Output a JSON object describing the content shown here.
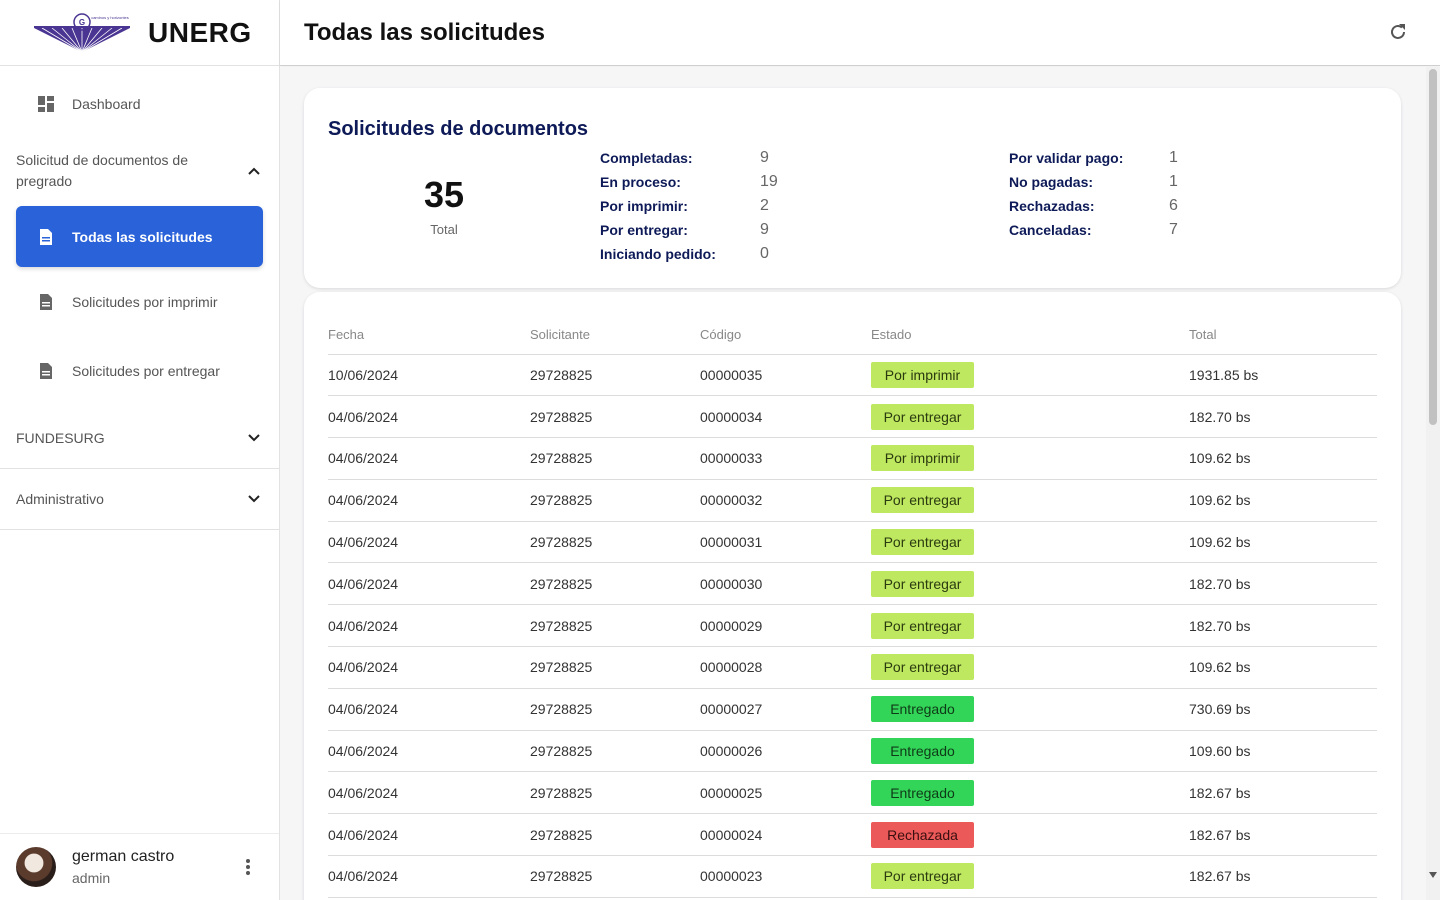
{
  "brand": {
    "name": "UNERG",
    "logo_tagline": "caminos y horizontes"
  },
  "header": {
    "title": "Todas las solicitudes"
  },
  "sidebar": {
    "dashboard": "Dashboard",
    "group_undergrad": "Solicitud de documentos de pregrado",
    "sub_items": [
      "Todas las solicitudes",
      "Solicitudes por imprimir",
      "Solicitudes por entregar"
    ],
    "group_fund": "FUNDESURG",
    "group_admin": "Administrativo"
  },
  "user": {
    "name": "german castro",
    "role": "admin"
  },
  "summary": {
    "title": "Solicitudes de documentos",
    "total": "35",
    "total_label": "Total",
    "col1": [
      {
        "label": "Completadas:",
        "value": "9"
      },
      {
        "label": "En proceso:",
        "value": "19"
      },
      {
        "label": "Por imprimir:",
        "value": "2"
      },
      {
        "label": "Por entregar:",
        "value": "9"
      },
      {
        "label": "Iniciando pedido:",
        "value": "0"
      }
    ],
    "col2": [
      {
        "label": "Por validar pago:",
        "value": "1"
      },
      {
        "label": "No pagadas:",
        "value": "1"
      },
      {
        "label": "Rechazadas:",
        "value": "6"
      },
      {
        "label": "Canceladas:",
        "value": "7"
      }
    ]
  },
  "table": {
    "headers": [
      "Fecha",
      "Solicitante",
      "Código",
      "Estado",
      "Total"
    ],
    "status_colors": {
      "Por imprimir": "#bde85f",
      "Por entregar": "#bde85f",
      "Entregado": "#32d558",
      "Rechazada": "#ec5959"
    },
    "rows": [
      {
        "fecha": "10/06/2024",
        "solicitante": "29728825",
        "codigo": "00000035",
        "estado": "Por imprimir",
        "total": "1931.85 bs"
      },
      {
        "fecha": "04/06/2024",
        "solicitante": "29728825",
        "codigo": "00000034",
        "estado": "Por entregar",
        "total": "182.70 bs"
      },
      {
        "fecha": "04/06/2024",
        "solicitante": "29728825",
        "codigo": "00000033",
        "estado": "Por imprimir",
        "total": "109.62 bs"
      },
      {
        "fecha": "04/06/2024",
        "solicitante": "29728825",
        "codigo": "00000032",
        "estado": "Por entregar",
        "total": "109.62 bs"
      },
      {
        "fecha": "04/06/2024",
        "solicitante": "29728825",
        "codigo": "00000031",
        "estado": "Por entregar",
        "total": "109.62 bs"
      },
      {
        "fecha": "04/06/2024",
        "solicitante": "29728825",
        "codigo": "00000030",
        "estado": "Por entregar",
        "total": "182.70 bs"
      },
      {
        "fecha": "04/06/2024",
        "solicitante": "29728825",
        "codigo": "00000029",
        "estado": "Por entregar",
        "total": "182.70 bs"
      },
      {
        "fecha": "04/06/2024",
        "solicitante": "29728825",
        "codigo": "00000028",
        "estado": "Por entregar",
        "total": "109.62 bs"
      },
      {
        "fecha": "04/06/2024",
        "solicitante": "29728825",
        "codigo": "00000027",
        "estado": "Entregado",
        "total": "730.69 bs"
      },
      {
        "fecha": "04/06/2024",
        "solicitante": "29728825",
        "codigo": "00000026",
        "estado": "Entregado",
        "total": "109.60 bs"
      },
      {
        "fecha": "04/06/2024",
        "solicitante": "29728825",
        "codigo": "00000025",
        "estado": "Entregado",
        "total": "182.67 bs"
      },
      {
        "fecha": "04/06/2024",
        "solicitante": "29728825",
        "codigo": "00000024",
        "estado": "Rechazada",
        "total": "182.67 bs"
      },
      {
        "fecha": "04/06/2024",
        "solicitante": "29728825",
        "codigo": "00000023",
        "estado": "Por entregar",
        "total": "182.67 bs"
      }
    ]
  }
}
